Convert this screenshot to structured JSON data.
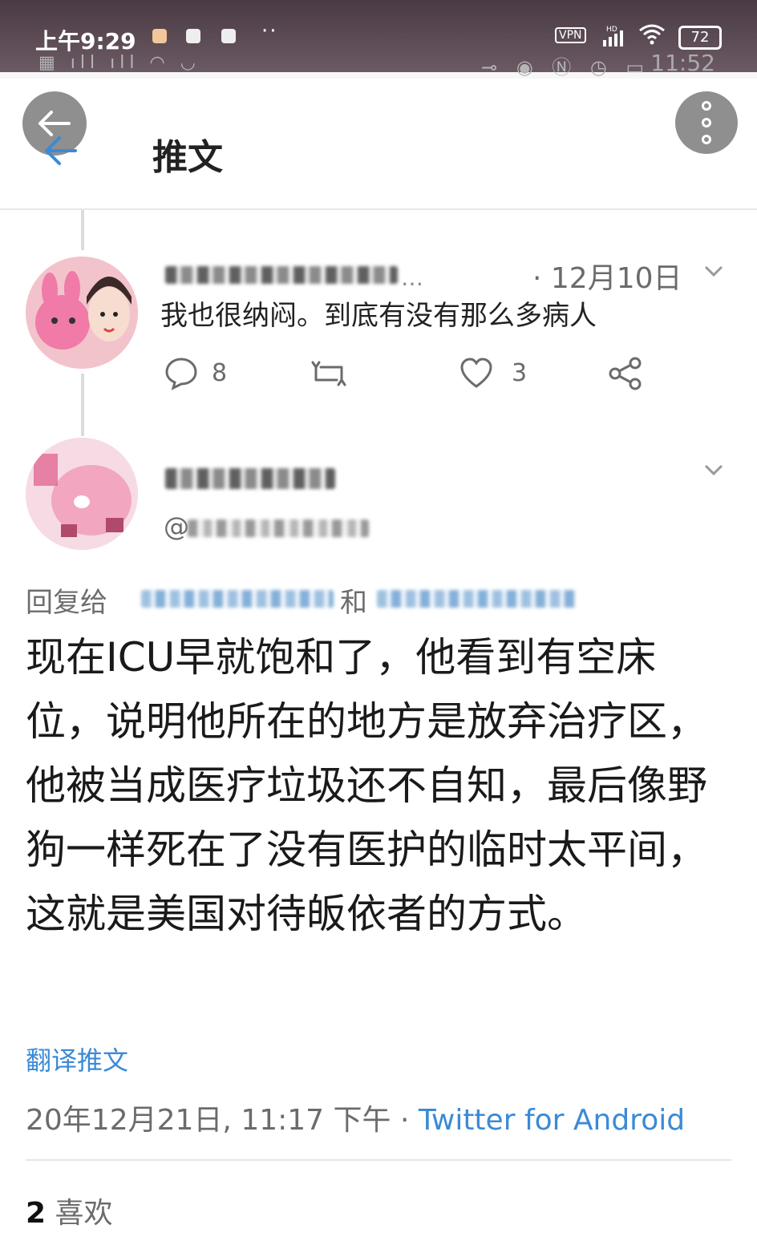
{
  "status_bar": {
    "time": "上午9:29",
    "more": "··",
    "vpn": "VPN",
    "signal": "HD",
    "battery": "72"
  },
  "ghost_status_bar": {
    "time": "11:52"
  },
  "header": {
    "title": "推文"
  },
  "reply_tweet": {
    "date": "· 12月10日",
    "handle_tail": "…",
    "text": "我也很纳闷。到底有没有那么多病人",
    "reply_count": "8",
    "like_count": "3"
  },
  "main_tweet": {
    "reply_to_label": "回复给",
    "reply_to_and": "和",
    "handle_at": "@",
    "text": "现在ICU早就饱和了，他看到有空床位，说明他所在的地方是放弃治疗区，他被当成医疗垃圾还不自知，最后像野狗一样死在了没有医护的临时太平间，这就是美国对待皈依者的方式。",
    "translate_label": "翻译推文",
    "timestamp": "20年12月21日, 11:17 下午 · ",
    "client": "Twitter for Android",
    "likes_count": "2",
    "likes_label": "喜欢"
  },
  "colors": {
    "link_blue": "#3b8ad6",
    "muted_text": "#6b6b6b",
    "overlay_button": "#8f8f8f"
  }
}
